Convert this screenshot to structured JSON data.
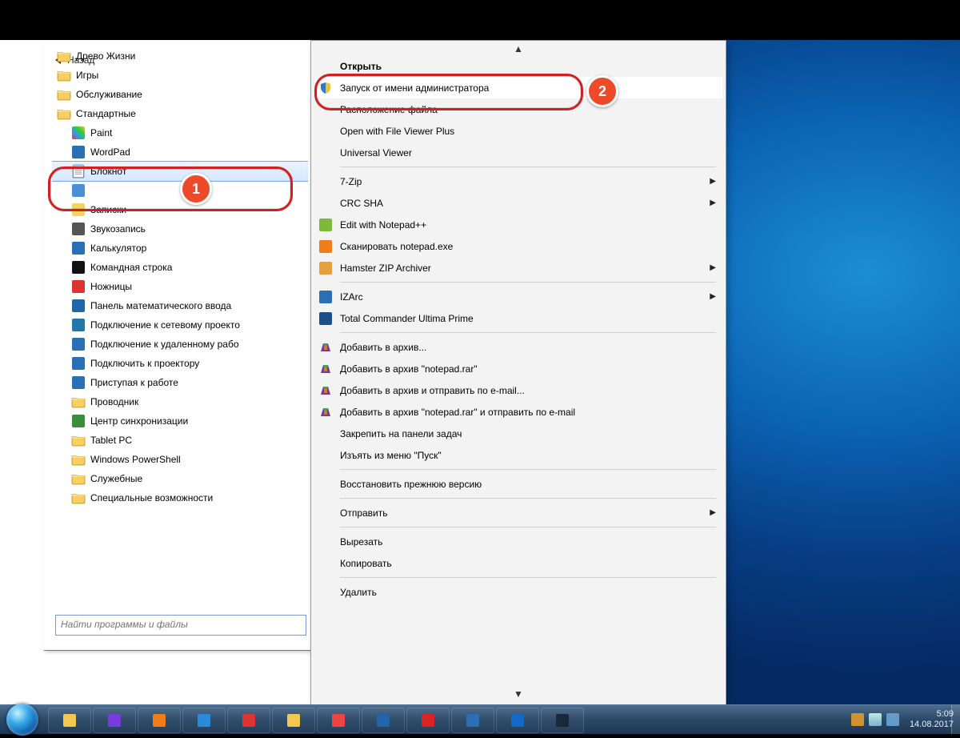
{
  "colors": {
    "badge": "#ec4a29",
    "highlight": "#d22020"
  },
  "start_menu": {
    "search_placeholder": "Найти программы и файлы",
    "back_label": "Назад",
    "tree": [
      {
        "indent": 0,
        "icon": "folder",
        "label": "Древо Жизни"
      },
      {
        "indent": 0,
        "icon": "folder",
        "label": "Игры"
      },
      {
        "indent": 0,
        "icon": "folder",
        "label": "Обслуживание"
      },
      {
        "indent": 0,
        "icon": "folder",
        "label": "Стандартные"
      },
      {
        "indent": 1,
        "icon": "paint",
        "label": "Paint"
      },
      {
        "indent": 1,
        "icon": "wordpad",
        "label": "WordPad"
      },
      {
        "indent": 1,
        "icon": "notepad",
        "label": "Блокнот",
        "selected": true
      },
      {
        "indent": 1,
        "icon": "run",
        "label": ""
      },
      {
        "indent": 1,
        "icon": "sticky",
        "label": "Записки"
      },
      {
        "indent": 1,
        "icon": "mic",
        "label": "Звукозапись"
      },
      {
        "indent": 1,
        "icon": "calc",
        "label": "Калькулятор"
      },
      {
        "indent": 1,
        "icon": "cmd",
        "label": "Командная строка"
      },
      {
        "indent": 1,
        "icon": "snip",
        "label": "Ножницы"
      },
      {
        "indent": 1,
        "icon": "mathinput",
        "label": "Панель математического ввода"
      },
      {
        "indent": 1,
        "icon": "netproj",
        "label": "Подключение к сетевому проекто"
      },
      {
        "indent": 1,
        "icon": "rdp",
        "label": "Подключение к удаленному рабо"
      },
      {
        "indent": 1,
        "icon": "proj",
        "label": "Подключить к проектору"
      },
      {
        "indent": 1,
        "icon": "getstart",
        "label": "Приступая к работе"
      },
      {
        "indent": 1,
        "icon": "explorer",
        "label": "Проводник"
      },
      {
        "indent": 1,
        "icon": "sync",
        "label": "Центр синхронизации"
      },
      {
        "indent": 1,
        "icon": "folder",
        "label": "Tablet PC"
      },
      {
        "indent": 1,
        "icon": "folder",
        "label": "Windows PowerShell"
      },
      {
        "indent": 1,
        "icon": "folder",
        "label": "Служебные"
      },
      {
        "indent": 1,
        "icon": "folder",
        "label": "Специальные возможности"
      }
    ]
  },
  "badges": {
    "one": "1",
    "two": "2"
  },
  "context_menu": {
    "top_default": "Открыть",
    "items": [
      {
        "icon": "shield",
        "label": "Запуск от имени администратора",
        "highlight": true
      },
      {
        "icon": null,
        "label": "Расположение файла"
      },
      {
        "icon": null,
        "label": "Open with File Viewer Plus"
      },
      {
        "icon": null,
        "label": "Universal Viewer"
      },
      {
        "sep": true
      },
      {
        "icon": null,
        "label": "7-Zip",
        "submenu": true
      },
      {
        "icon": null,
        "label": "CRC SHA",
        "submenu": true
      },
      {
        "icon": "npp",
        "label": "Edit with Notepad++"
      },
      {
        "icon": "avast",
        "label": "Сканировать notepad.exe"
      },
      {
        "icon": "hamster",
        "label": "Hamster ZIP Archiver",
        "submenu": true
      },
      {
        "sep": true
      },
      {
        "icon": "izarc",
        "label": "IZArc",
        "submenu": true
      },
      {
        "icon": "tc",
        "label": "Total Commander Ultima Prime"
      },
      {
        "sep": true
      },
      {
        "icon": "winrar",
        "label": "Добавить в архив..."
      },
      {
        "icon": "winrar",
        "label": "Добавить в архив \"notepad.rar\""
      },
      {
        "icon": "winrar",
        "label": "Добавить в архив и отправить по e-mail..."
      },
      {
        "icon": "winrar",
        "label": "Добавить в архив \"notepad.rar\" и отправить по e-mail"
      },
      {
        "icon": null,
        "label": "Закрепить на панели задач"
      },
      {
        "icon": null,
        "label": "Изъять из меню \"Пуск\""
      },
      {
        "sep": true
      },
      {
        "icon": null,
        "label": "Восстановить прежнюю версию"
      },
      {
        "sep": true
      },
      {
        "icon": null,
        "label": "Отправить",
        "submenu": true
      },
      {
        "sep": true
      },
      {
        "icon": null,
        "label": "Вырезать"
      },
      {
        "icon": null,
        "label": "Копировать"
      },
      {
        "sep": true
      },
      {
        "icon": null,
        "label": "Удалить"
      }
    ]
  },
  "taskbar": {
    "time": "5:09",
    "date": "14.08.2017",
    "buttons": [
      "explorer",
      "wmp-purple",
      "wmp-orange",
      "ie",
      "skitch",
      "folder",
      "chrome",
      "browser",
      "yandex",
      "photos",
      "teamviewer",
      "steam"
    ]
  }
}
